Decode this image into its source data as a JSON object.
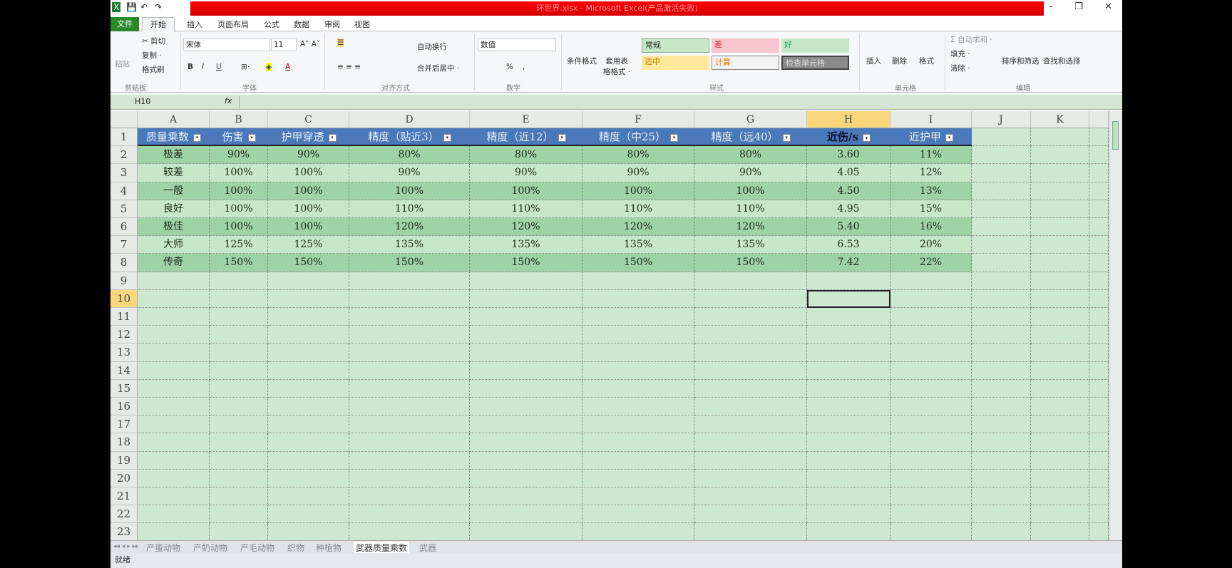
{
  "window": {
    "title": "环世界.xlsx - Microsoft Excel(产品激活失败)",
    "controls": [
      "–",
      "❐",
      "✕"
    ]
  },
  "quick_access": [
    "💾",
    "↶",
    "↷"
  ],
  "ribbon_tabs": {
    "file": "文件",
    "items": [
      "开始",
      "插入",
      "页面布局",
      "公式",
      "数据",
      "审阅",
      "视图"
    ]
  },
  "ribbon": {
    "clipboard": {
      "paste": "粘贴",
      "cut": "剪切",
      "copy": "复制 ·",
      "format_painter": "格式刷",
      "group": "剪贴板"
    },
    "font": {
      "name": "宋体",
      "size": "11",
      "group": "字体",
      "bold": "B",
      "italic": "I",
      "underline": "U"
    },
    "alignment": {
      "wrap": "自动换行",
      "merge": "合并后居中 ·",
      "group": "对齐方式"
    },
    "number": {
      "format": "数值",
      "percent": "%",
      "comma": ",",
      "group": "数字"
    },
    "styles": {
      "conditional": "条件格式",
      "table": "套用表格格式 ·",
      "normal": "常规",
      "bad": "差",
      "good": "好",
      "neutral": "适中",
      "calc": "计算",
      "check": "检查单元格",
      "group": "样式"
    },
    "cells": {
      "insert": "插入",
      "delete": "删除",
      "format": "格式",
      "group": "单元格"
    },
    "editing": {
      "autosum": "Σ 自动求和 ·",
      "fill": "填充 ·",
      "clear": "清除 ·",
      "sort": "排序和筛选",
      "find": "查找和选择",
      "group": "编辑"
    }
  },
  "formula_bar": {
    "name_box": "H10",
    "fx": "fx",
    "value": ""
  },
  "columns": [
    "A",
    "B",
    "C",
    "D",
    "E",
    "F",
    "G",
    "H",
    "I",
    "J",
    "K"
  ],
  "selected_cell": "H10",
  "table": {
    "headers": [
      "质量乘数",
      "伤害",
      "护甲穿透",
      "精度（贴近3）",
      "精度（近12）",
      "精度（中25）",
      "精度（远40）",
      "近伤/s",
      "近护甲"
    ],
    "rows": [
      [
        "极差",
        "90%",
        "90%",
        "80%",
        "80%",
        "80%",
        "80%",
        "3.60",
        "11%"
      ],
      [
        "较差",
        "100%",
        "100%",
        "90%",
        "90%",
        "90%",
        "90%",
        "4.05",
        "12%"
      ],
      [
        "一般",
        "100%",
        "100%",
        "100%",
        "100%",
        "100%",
        "100%",
        "4.50",
        "13%"
      ],
      [
        "良好",
        "100%",
        "100%",
        "110%",
        "110%",
        "110%",
        "110%",
        "4.95",
        "15%"
      ],
      [
        "极佳",
        "100%",
        "100%",
        "120%",
        "120%",
        "120%",
        "120%",
        "5.40",
        "16%"
      ],
      [
        "大师",
        "125%",
        "125%",
        "135%",
        "135%",
        "135%",
        "135%",
        "6.53",
        "20%"
      ],
      [
        "传奇",
        "150%",
        "150%",
        "150%",
        "150%",
        "150%",
        "150%",
        "7.42",
        "22%"
      ]
    ]
  },
  "row_count": 23,
  "sheet_tabs": {
    "items": [
      "产蛋动物",
      "产奶动物",
      "产毛动物",
      "织物",
      "种植物",
      "武器质量乘数",
      "武器"
    ],
    "active": "武器质量乘数"
  },
  "status": {
    "text": "就绪"
  },
  "colors": {
    "header": "#4a78b8",
    "band_dark": "#9ed3a6",
    "band_light": "#c6e8c8",
    "sheet_bg": "#cce8cf",
    "title_bar": "#e00000"
  }
}
